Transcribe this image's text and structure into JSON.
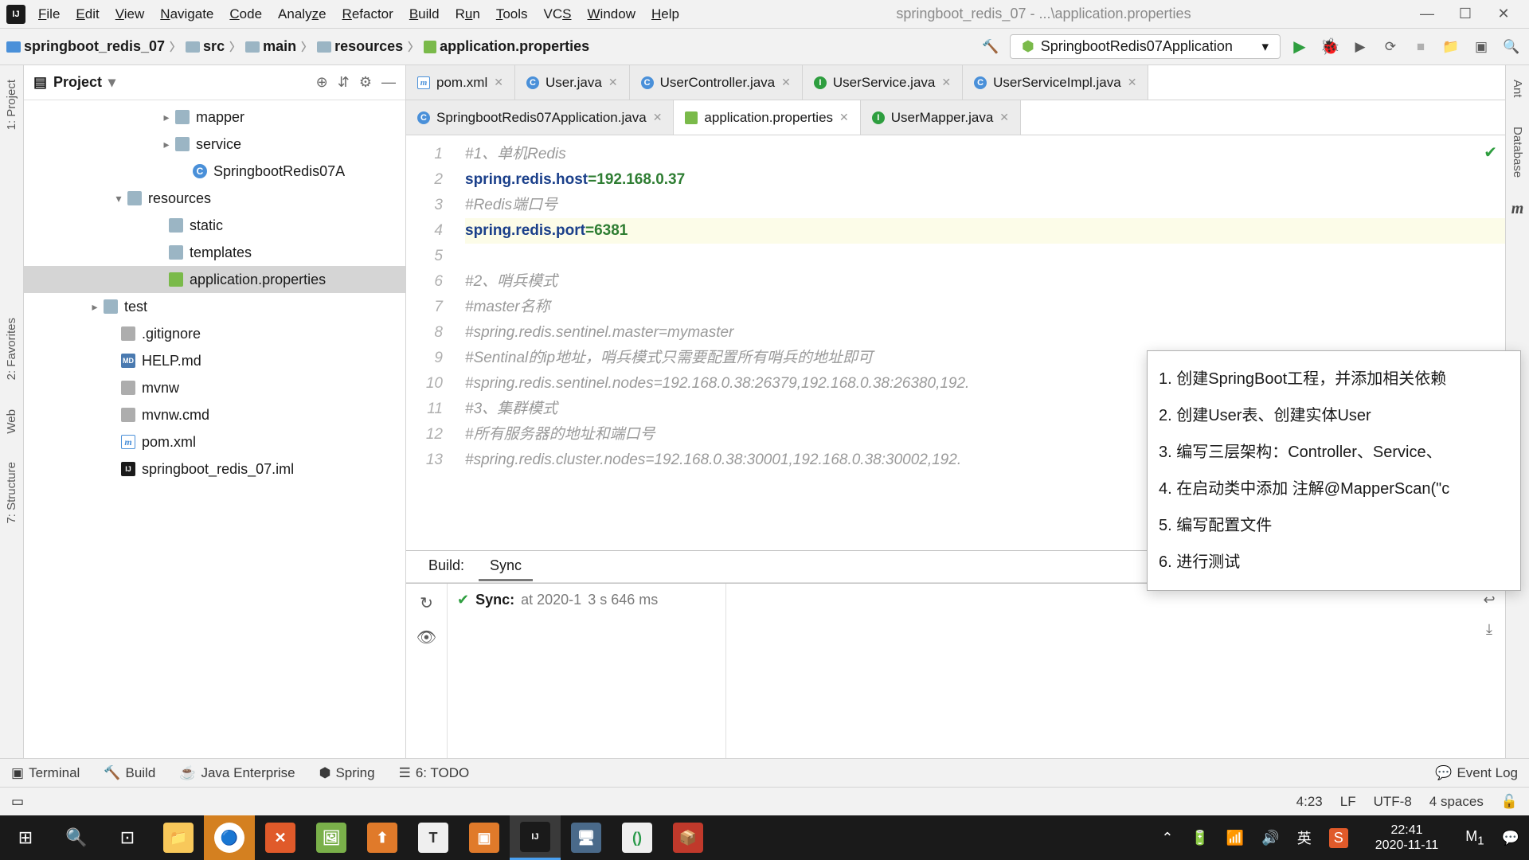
{
  "title_bar": {
    "menus": [
      "File",
      "Edit",
      "View",
      "Navigate",
      "Code",
      "Analyze",
      "Refactor",
      "Build",
      "Run",
      "Tools",
      "VCS",
      "Window",
      "Help"
    ],
    "title": "springboot_redis_07 - ...\\application.properties"
  },
  "breadcrumbs": [
    "springboot_redis_07",
    "src",
    "main",
    "resources",
    "application.properties"
  ],
  "run_config": "SpringbootRedis07Application",
  "project": {
    "header": "Project",
    "tree": [
      {
        "indent": 160,
        "arrow": "▸",
        "icon": "folder",
        "label": "mapper"
      },
      {
        "indent": 160,
        "arrow": "▸",
        "icon": "folder",
        "label": "service"
      },
      {
        "indent": 182,
        "arrow": "",
        "icon": "c",
        "label": "SpringbootRedis07A"
      },
      {
        "indent": 100,
        "arrow": "▾",
        "icon": "folder",
        "label": "resources"
      },
      {
        "indent": 152,
        "arrow": "",
        "icon": "folder",
        "label": "static"
      },
      {
        "indent": 152,
        "arrow": "",
        "icon": "folder",
        "label": "templates"
      },
      {
        "indent": 152,
        "arrow": "",
        "icon": "prop",
        "label": "application.properties",
        "sel": true
      },
      {
        "indent": 70,
        "arrow": "▸",
        "icon": "folder",
        "label": "test"
      },
      {
        "indent": 92,
        "arrow": "",
        "icon": "txt",
        "label": ".gitignore"
      },
      {
        "indent": 92,
        "arrow": "",
        "icon": "md",
        "label": "HELP.md"
      },
      {
        "indent": 92,
        "arrow": "",
        "icon": "txt",
        "label": "mvnw"
      },
      {
        "indent": 92,
        "arrow": "",
        "icon": "txt",
        "label": "mvnw.cmd"
      },
      {
        "indent": 92,
        "arrow": "",
        "icon": "m",
        "label": "pom.xml"
      },
      {
        "indent": 92,
        "arrow": "",
        "icon": "ij",
        "label": "springboot_redis_07.iml"
      }
    ]
  },
  "tabs_row1": [
    {
      "icon": "m",
      "label": "pom.xml"
    },
    {
      "icon": "c",
      "label": "User.java"
    },
    {
      "icon": "c",
      "label": "UserController.java"
    },
    {
      "icon": "i",
      "label": "UserService.java"
    },
    {
      "icon": "c",
      "label": "UserServiceImpl.java"
    }
  ],
  "tabs_row2": [
    {
      "icon": "c",
      "label": "SpringbootRedis07Application.java"
    },
    {
      "icon": "prop",
      "label": "application.properties",
      "active": true
    },
    {
      "icon": "i",
      "label": "UserMapper.java"
    }
  ],
  "code_lines": [
    {
      "n": "1",
      "type": "cmt",
      "text": "#1、单机Redis"
    },
    {
      "n": "2",
      "type": "kv",
      "k": "spring.redis.host",
      "v": "192.168.0.37"
    },
    {
      "n": "3",
      "type": "cmt",
      "text": "#Redis端口号"
    },
    {
      "n": "4",
      "type": "kv",
      "k": "spring.redis.port",
      "v": "6381",
      "hl": true
    },
    {
      "n": "5",
      "type": "blank",
      "text": ""
    },
    {
      "n": "6",
      "type": "cmt",
      "text": "#2、哨兵模式"
    },
    {
      "n": "7",
      "type": "cmt",
      "text": "#master名称"
    },
    {
      "n": "8",
      "type": "cmt",
      "text": "#spring.redis.sentinel.master=mymaster"
    },
    {
      "n": "9",
      "type": "cmt",
      "text": "#Sentinal的ip地址，哨兵模式只需要配置所有哨兵的地址即可"
    },
    {
      "n": "10",
      "type": "cmt",
      "text": "#spring.redis.sentinel.nodes=192.168.0.38:26379,192.168.0.38:26380,192."
    },
    {
      "n": "11",
      "type": "cmt",
      "text": "#3、集群模式"
    },
    {
      "n": "12",
      "type": "cmt",
      "text": "#所有服务器的地址和端口号"
    },
    {
      "n": "13",
      "type": "cmt",
      "text": "#spring.redis.cluster.nodes=192.168.0.38:30001,192.168.0.38:30002,192."
    }
  ],
  "popup_items": [
    "1. 创建SpringBoot工程，并添加相关依赖",
    "2. 创建User表、创建实体User",
    "3. 编写三层架构：Controller、Service、",
    "4. 在启动类中添加 注解@MapperScan(\"c",
    "5. 编写配置文件",
    "6. 进行测试"
  ],
  "build": {
    "header_tabs": [
      "Build:",
      "Sync"
    ],
    "sync_label": "Sync:",
    "sync_info": "at 2020-1",
    "sync_duration": "3 s 646 ms"
  },
  "bottom_tools": [
    "Terminal",
    "Build",
    "Java Enterprise",
    "Spring",
    "6: TODO"
  ],
  "bottom_right": "Event Log",
  "status": {
    "pos": "4:23",
    "eol": "LF",
    "enc": "UTF-8",
    "indent": "4 spaces"
  },
  "left_tools": [
    "1: Project",
    "2: Favorites",
    "Web",
    "7: Structure"
  ],
  "right_tools": [
    "Ant",
    "Database"
  ],
  "taskbar": {
    "time": "22:41",
    "date": "2020-11-11",
    "ime": "英",
    "tray_badge": "1"
  }
}
